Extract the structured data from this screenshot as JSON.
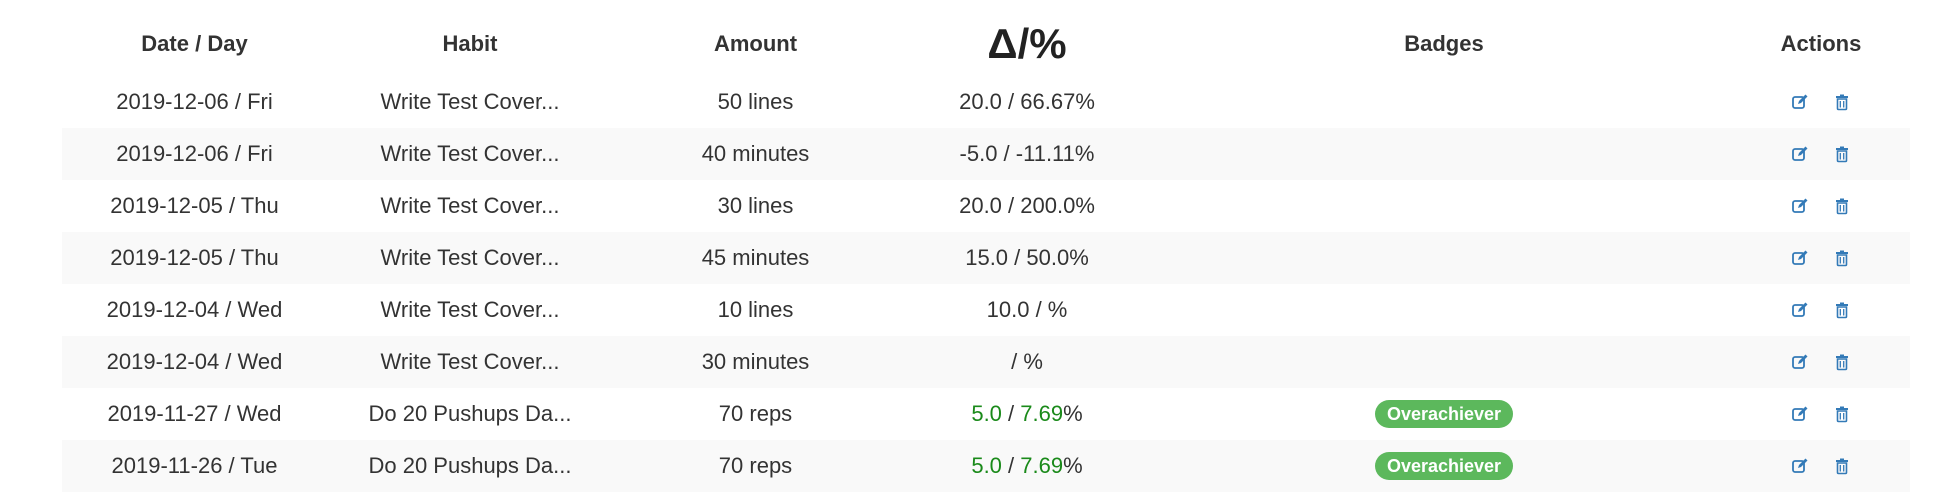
{
  "headers": {
    "date": "Date / Day",
    "habit": "Habit",
    "amount": "Amount",
    "delta_symbol": "Δ",
    "delta_sep": "/",
    "percent_symbol": "%",
    "badges": "Badges",
    "actions": "Actions"
  },
  "rows": [
    {
      "date": "2019-12-06 / Fri",
      "habit": "Write Test Cover...",
      "amount": "50 lines",
      "delta": "20.0",
      "sep": " / ",
      "pct": "66.67%",
      "pct_suffix": "",
      "badge": "",
      "green": false
    },
    {
      "date": "2019-12-06 / Fri",
      "habit": "Write Test Cover...",
      "amount": "40 minutes",
      "delta": "-5.0",
      "sep": " / ",
      "pct": "-11.11%",
      "pct_suffix": "",
      "badge": "",
      "green": false
    },
    {
      "date": "2019-12-05 / Thu",
      "habit": "Write Test Cover...",
      "amount": "30 lines",
      "delta": "20.0",
      "sep": " / ",
      "pct": "200.0%",
      "pct_suffix": "",
      "badge": "",
      "green": false
    },
    {
      "date": "2019-12-05 / Thu",
      "habit": "Write Test Cover...",
      "amount": "45 minutes",
      "delta": "15.0",
      "sep": " / ",
      "pct": "50.0%",
      "pct_suffix": "",
      "badge": "",
      "green": false
    },
    {
      "date": "2019-12-04 / Wed",
      "habit": "Write Test Cover...",
      "amount": "10 lines",
      "delta": "10.0",
      "sep": " / ",
      "pct": "%",
      "pct_suffix": "",
      "badge": "",
      "green": false
    },
    {
      "date": "2019-12-04 / Wed",
      "habit": "Write Test Cover...",
      "amount": "30 minutes",
      "delta": "",
      "sep": " / ",
      "pct": "%",
      "pct_suffix": "",
      "badge": "",
      "green": false
    },
    {
      "date": "2019-11-27 / Wed",
      "habit": "Do 20 Pushups Da...",
      "amount": "70 reps",
      "delta": "5.0",
      "sep": " / ",
      "pct": "7.69",
      "pct_suffix": "%",
      "badge": "Overachiever",
      "green": true
    },
    {
      "date": "2019-11-26 / Tue",
      "habit": "Do 20 Pushups Da...",
      "amount": "70 reps",
      "delta": "5.0",
      "sep": " / ",
      "pct": "7.69",
      "pct_suffix": "%",
      "badge": "Overachiever",
      "green": true
    }
  ],
  "icons": {
    "edit": "edit-icon",
    "delete": "trash-icon"
  },
  "colors": {
    "positive": "#1a8a1a",
    "badge": "#5cb85c",
    "action_icon": "#337ab7",
    "stripe": "#f9f9f9"
  }
}
